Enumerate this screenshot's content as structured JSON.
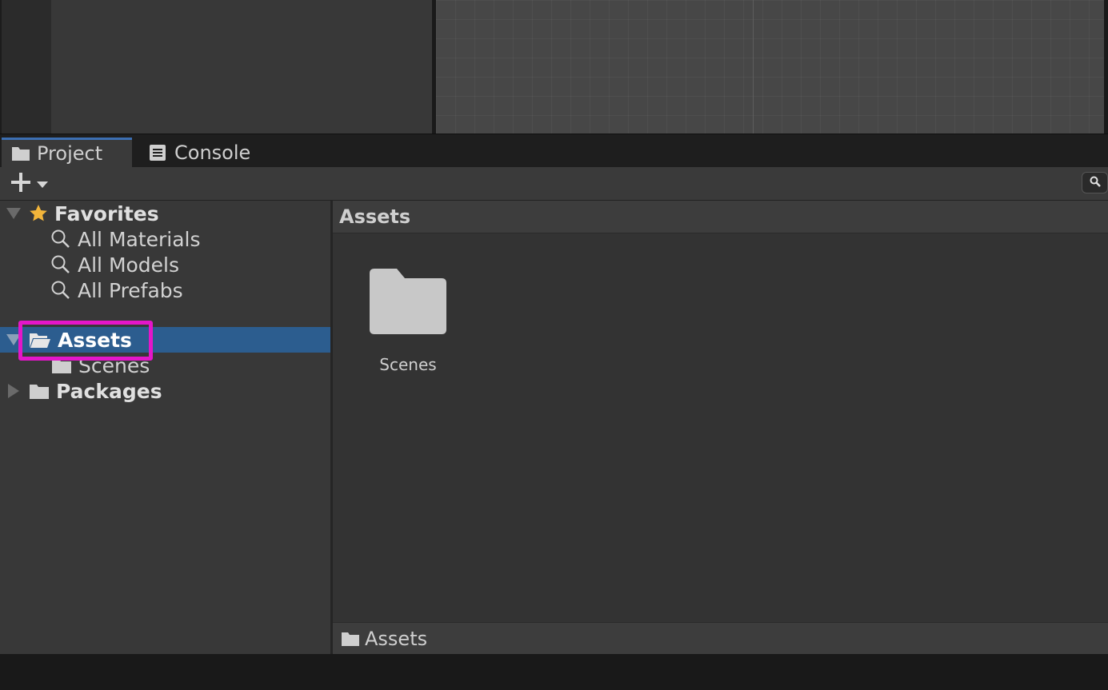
{
  "tabs": [
    {
      "label": "Project",
      "icon": "folder-icon",
      "active": true
    },
    {
      "label": "Console",
      "icon": "console-icon",
      "active": false
    }
  ],
  "toolbar": {
    "add_label": "+",
    "search_icon": "search-icon"
  },
  "tree": {
    "favorites": {
      "label": "Favorites",
      "items": [
        "All Materials",
        "All Models",
        "All Prefabs"
      ]
    },
    "assets": {
      "label": "Assets",
      "children": [
        "Scenes"
      ]
    },
    "packages": {
      "label": "Packages"
    }
  },
  "content": {
    "header": "Assets",
    "items": [
      {
        "label": "Scenes",
        "icon": "folder-icon"
      }
    ],
    "status_path": "Assets"
  },
  "colors": {
    "selection": "#2c5d8f",
    "highlight": "#e416c9",
    "favorites_star": "#f2b53a",
    "active_tab_accent": "#3c6fb3"
  }
}
